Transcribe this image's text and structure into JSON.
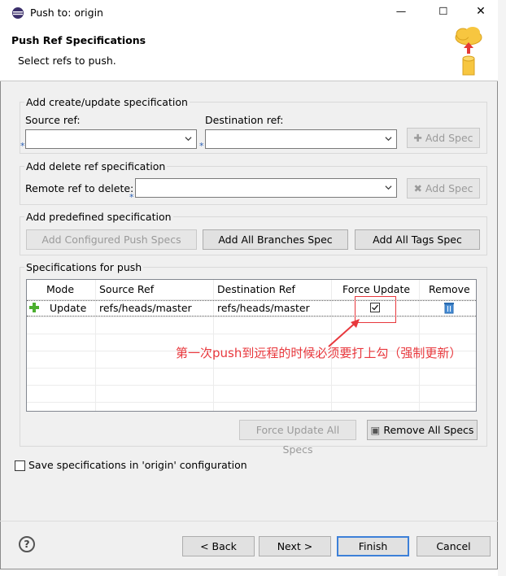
{
  "window": {
    "title": "Push to: origin",
    "controls": {
      "minimize": "—",
      "maximize": "☐",
      "close": "✕"
    }
  },
  "header": {
    "title": "Push Ref Specifications",
    "subtitle": "Select refs to push."
  },
  "create_group": {
    "label": "Add create/update specification",
    "source_label": "Source ref:",
    "destination_label": "Destination ref:",
    "add_spec": "Add Spec"
  },
  "delete_group": {
    "label": "Add delete ref specification",
    "remote_label": "Remote ref to delete:",
    "add_spec": "Add Spec"
  },
  "predefined_group": {
    "label": "Add predefined specification",
    "configured": "Add Configured Push Specs",
    "all_branches": "Add All Branches Spec",
    "all_tags": "Add All Tags Spec"
  },
  "specs_group": {
    "label": "Specifications for push",
    "columns": [
      "Mode",
      "Source Ref",
      "Destination Ref",
      "Force Update",
      "Remove"
    ],
    "rows": [
      {
        "mode": "Update",
        "source": "refs/heads/master",
        "destination": "refs/heads/master",
        "force_update": true
      }
    ],
    "force_update_all": "Force Update All Specs",
    "remove_all": "Remove All Specs"
  },
  "annotation": {
    "text": "第一次push到远程的时候必须要打上勾（强制更新）",
    "color": "#e8383d"
  },
  "save_config": {
    "label": "Save specifications in 'origin' configuration",
    "checked": false
  },
  "footer": {
    "help": "?",
    "back": "< Back",
    "next": "Next >",
    "finish": "Finish",
    "cancel": "Cancel"
  }
}
